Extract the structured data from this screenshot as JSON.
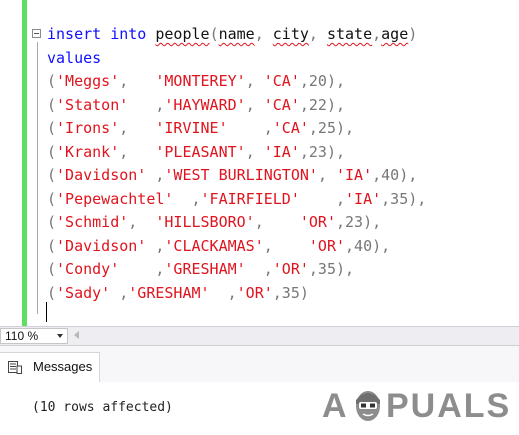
{
  "editor": {
    "line1": {
      "kw_insert": "insert",
      "kw_into": "into",
      "table": "people",
      "paren_open": "(",
      "col_name": "name",
      "comma1": ", ",
      "col_city": "city",
      "comma2": ", ",
      "col_state": "state",
      "comma3": ",",
      "col_age": "age",
      "paren_close": ")"
    },
    "line2": {
      "kw_values": "values"
    },
    "rows": [
      {
        "name": "'Meggs'",
        "gap1": ",   ",
        "city": "'MONTEREY'",
        "gap2": ", ",
        "state": "'CA'",
        "tail": ",20),"
      },
      {
        "name": "'Staton'",
        "gap1": "   ,",
        "city": "'HAYWARD'",
        "gap2": ", ",
        "state": "'CA'",
        "tail": ",22),"
      },
      {
        "name": "'Irons'",
        "gap1": ",   ",
        "city": "'IRVINE'",
        "gap2": "    ,",
        "state": "'CA'",
        "tail": ",25),"
      },
      {
        "name": "'Krank'",
        "gap1": ",   ",
        "city": "'PLEASANT'",
        "gap2": ", ",
        "state": "'IA'",
        "tail": ",23),"
      },
      {
        "name": "'Davidson'",
        "gap1": " ,",
        "city": "'WEST BURLINGTON'",
        "gap2": ", ",
        "state": "'IA'",
        "tail": ",40),"
      },
      {
        "name": "'Pepewachtel'",
        "gap1": "  ,",
        "city": "'FAIRFIELD'",
        "gap2": "    ,",
        "state": "'IA'",
        "tail": ",35),"
      },
      {
        "name": "'Schmid'",
        "gap1": ",  ",
        "city": "'HILLSBORO'",
        "gap2": ",    ",
        "state": "'OR'",
        "tail": ",23),"
      },
      {
        "name": "'Davidson'",
        "gap1": " ,",
        "city": "'CLACKAMAS'",
        "gap2": ",    ",
        "state": "'OR'",
        "tail": ",40),"
      },
      {
        "name": "'Condy'",
        "gap1": "    ,",
        "city": "'GRESHAM'",
        "gap2": "  ,",
        "state": "'OR'",
        "tail": ",35),"
      },
      {
        "name": "'Sady'",
        "gap1": " ,",
        "city": "'GRESHAM'",
        "gap2": "  ,",
        "state": "'OR'",
        "tail": ",35)"
      }
    ]
  },
  "statusbar": {
    "zoom": "110 %"
  },
  "messages": {
    "tab_label": "Messages",
    "result": "(10 rows affected)"
  },
  "watermark": {
    "left": "A",
    "right": "PUALS"
  },
  "colors": {
    "keyword": "#1010ff",
    "string": "#e0141e",
    "change_bar": "#5ee05e"
  },
  "icons": [
    "collapse-minus-icon",
    "dropdown-arrow-icon",
    "scroll-left-icon",
    "messages-icon"
  ]
}
